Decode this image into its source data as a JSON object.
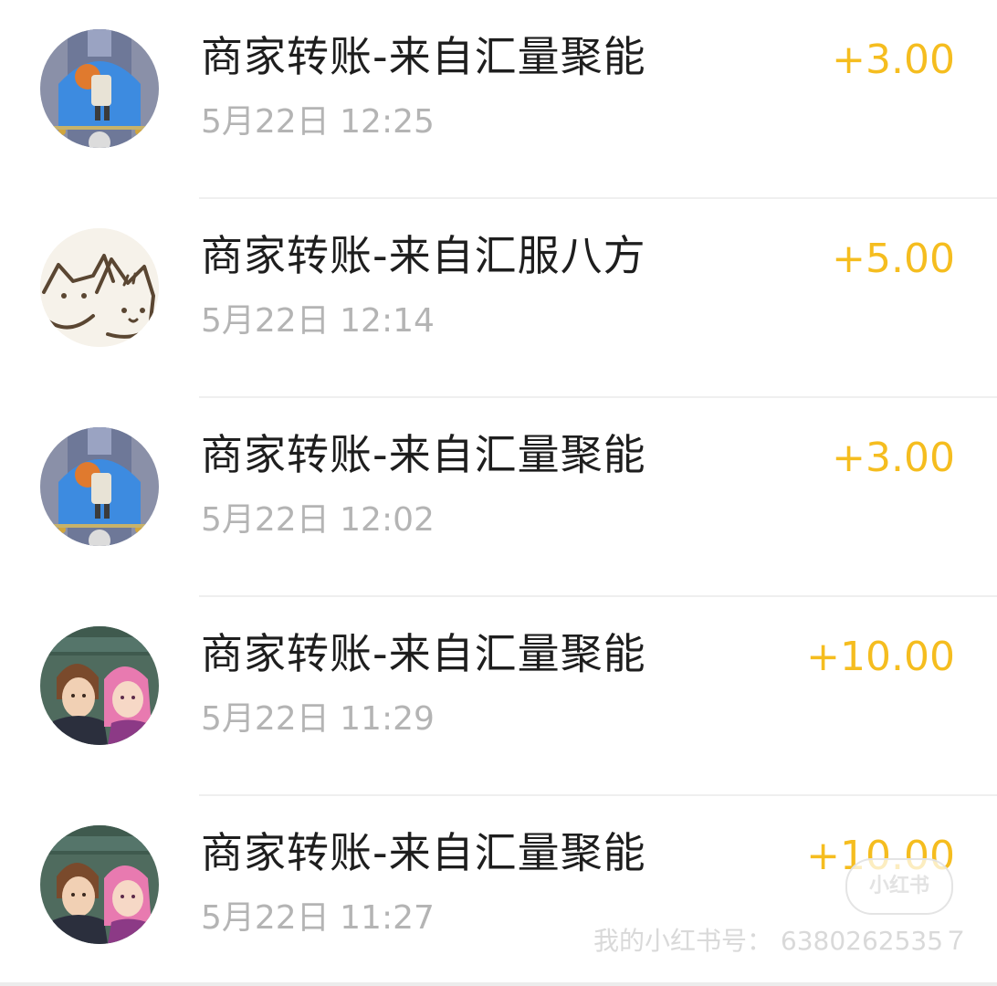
{
  "transactions": [
    {
      "title": "商家转账-来自汇量聚能",
      "time": "5月22日 12:25",
      "amount": "+3.00",
      "avatar": "game-character-avatar"
    },
    {
      "title": "商家转账-来自汇服八方",
      "time": "5月22日 12:14",
      "amount": "+5.00",
      "avatar": "cats-avatar"
    },
    {
      "title": "商家转账-来自汇量聚能",
      "time": "5月22日 12:02",
      "amount": "+3.00",
      "avatar": "game-character-avatar"
    },
    {
      "title": "商家转账-来自汇量聚能",
      "time": "5月22日 11:29",
      "amount": "+10.00",
      "avatar": "anime-couple-avatar"
    },
    {
      "title": "商家转账-来自汇量聚能",
      "time": "5月22日 11:27",
      "amount": "+10.00",
      "avatar": "anime-couple-avatar"
    }
  ],
  "watermark": {
    "badge": "小红书",
    "id_text": "我的小红书号： 6380262535７"
  },
  "colors": {
    "amount": "#f5bd1f",
    "title": "#1e1e1e",
    "time": "#b4b4b4",
    "divider": "#efefef"
  }
}
